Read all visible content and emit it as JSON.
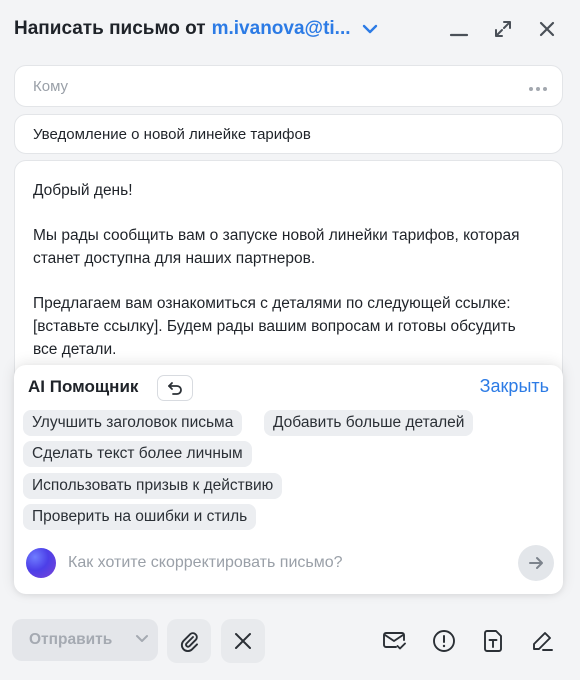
{
  "header": {
    "title": "Написать письмо от",
    "from": "m.ivanova@ti...",
    "icons": [
      "chevron-down-icon",
      "minimize-icon",
      "expand-icon",
      "close-icon"
    ]
  },
  "to_field": {
    "placeholder": "Кому"
  },
  "subject": {
    "value": "Уведомление о новой линейке тарифов"
  },
  "body": {
    "paragraphs": [
      "Добрый день!",
      "Мы рады сообщить вам о запуске новой линейки тарифов, которая станет доступна для наших партнеров.",
      "Предлагаем вам ознакомиться с деталями по следующей ссылке: [вставьте ссылку]. Будем рады вашим вопросам и готовы обсудить все детали."
    ]
  },
  "ai_panel": {
    "title": "AI Помощник",
    "close_label": "Закрыть",
    "suggestions": [
      "Улучшить заголовок письма",
      "Добавить больше деталей",
      "Сделать текст более личным",
      "Использовать призыв к действию",
      "Проверить на ошибки и стиль"
    ],
    "input_placeholder": "Как хотите скорректировать письмо?"
  },
  "footer": {
    "send_label": "Отправить",
    "icons": [
      "attach-icon",
      "discard-icon",
      "read-receipt-icon",
      "important-icon",
      "template-icon",
      "signature-icon"
    ]
  },
  "colors": {
    "accent": "#2c7be5",
    "background": "#f3f4f6",
    "chip": "#eceef1"
  }
}
